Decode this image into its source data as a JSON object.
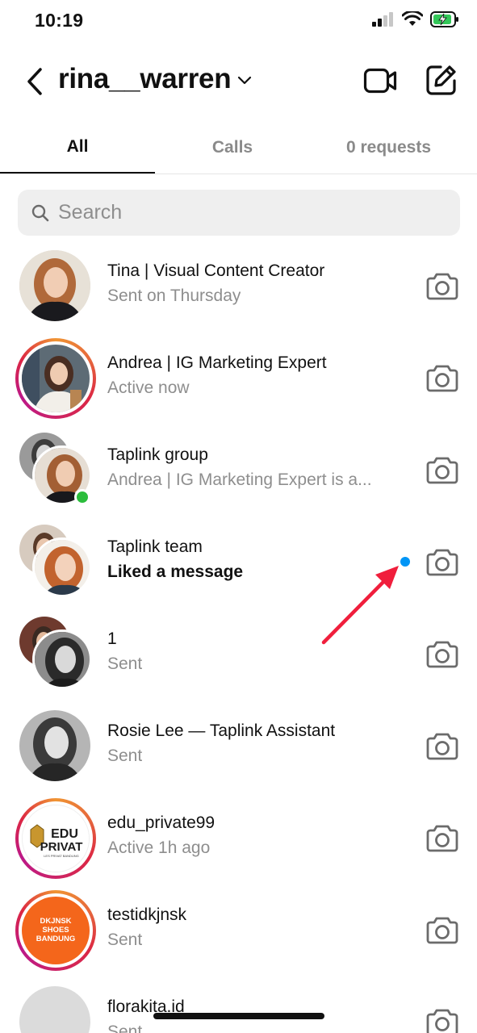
{
  "status_bar": {
    "time": "10:19"
  },
  "header": {
    "username": "rina__warren"
  },
  "tabs": [
    {
      "label": "All"
    },
    {
      "label": "Calls"
    },
    {
      "label": "0 requests"
    }
  ],
  "search": {
    "placeholder": "Search"
  },
  "conversations": [
    {
      "name": "Tina | Visual Content Creator",
      "status": "Sent on Thursday"
    },
    {
      "name": "Andrea | IG Marketing Expert",
      "status": "Active now"
    },
    {
      "name": "Taplink group",
      "status": "Andrea | IG Marketing Expert is a..."
    },
    {
      "name": "Taplink team",
      "status": "Liked a message"
    },
    {
      "name": "1",
      "status": "Sent"
    },
    {
      "name": "Rosie Lee — Taplink Assistant",
      "status": "Sent"
    },
    {
      "name": "edu_private99",
      "status": "Active 1h ago"
    },
    {
      "name": "testidkjnsk",
      "status": "Sent"
    },
    {
      "name": "florakita.id",
      "status": "Sent"
    }
  ],
  "logos": {
    "edu": {
      "line1": "EDU",
      "line2": "PRIVAT",
      "tagline": "LES PRIVAT BANDUNG"
    },
    "shoes": {
      "line1": "DKJNSK",
      "line2": "SHOES",
      "line3": "BANDUNG"
    }
  },
  "colors": {
    "accent": "#0095f6",
    "online": "#2bbd3c",
    "annotation_arrow": "#f01e3c",
    "shoes_brand": "#f4661b"
  }
}
